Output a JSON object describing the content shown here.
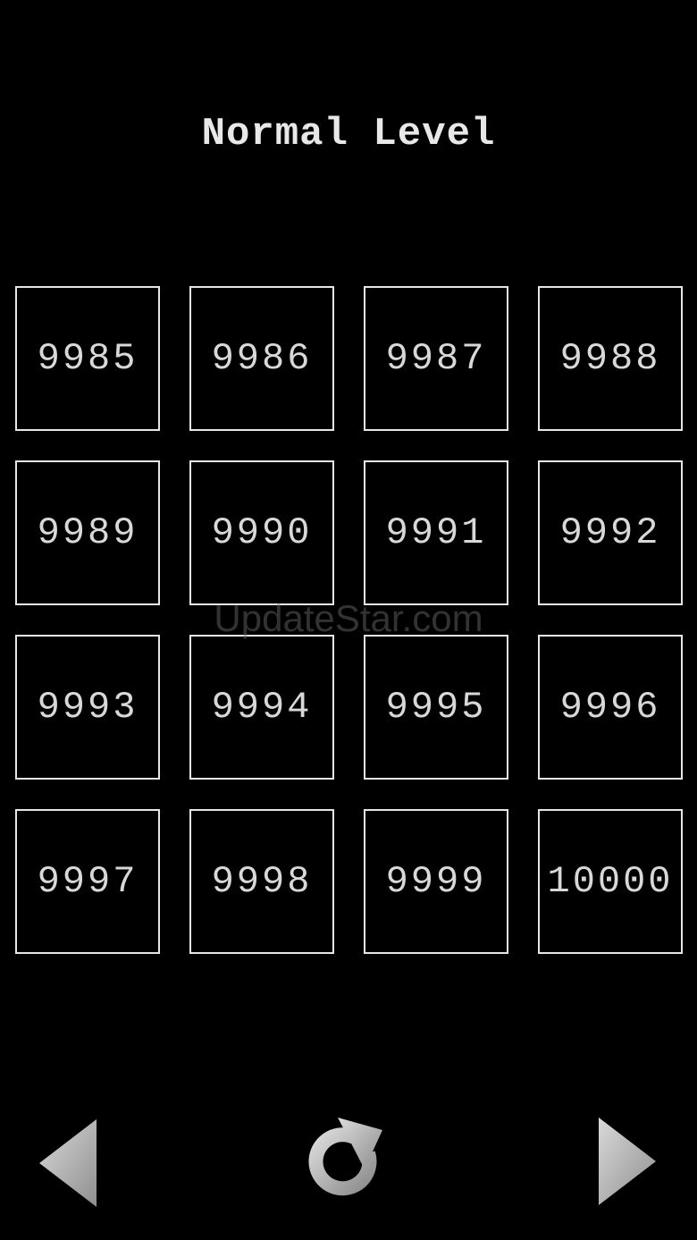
{
  "header": {
    "title": "Normal Level"
  },
  "levels": [
    "9985",
    "9986",
    "9987",
    "9988",
    "9989",
    "9990",
    "9991",
    "9992",
    "9993",
    "9994",
    "9995",
    "9996",
    "9997",
    "9998",
    "9999",
    "10000"
  ],
  "watermark": "UpdateStar.com",
  "nav": {
    "prev_icon": "triangle-left-icon",
    "reload_icon": "refresh-icon",
    "next_icon": "triangle-right-icon"
  },
  "colors": {
    "background": "#000000",
    "tile_border": "#e6e6e6",
    "text": "#d8d8d8",
    "icon": "#bdbdbd"
  }
}
